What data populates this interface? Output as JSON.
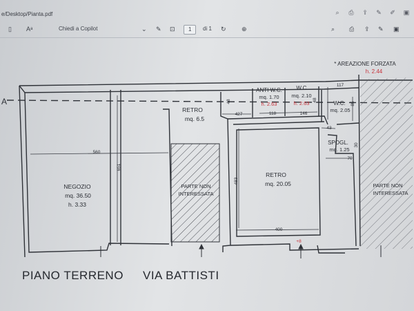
{
  "browser": {
    "url": "e/Desktop/Pianta.pdf",
    "tab_icons": [
      "back-icon",
      "print-icon",
      "share-icon",
      "highlight-icon",
      "draw-icon",
      "save-icon"
    ]
  },
  "toolbar": {
    "ask_copilot": "Chiedi a Copilot",
    "page_current": "1",
    "page_total": "di 1",
    "icons": [
      "sidebar-icon",
      "read-aloud-icon",
      "draw-icon",
      "fit-page-icon",
      "rotate-icon",
      "zoom-icon"
    ]
  },
  "plan": {
    "left_marker": "A",
    "aeration": {
      "title": "* AREAZIONE FORZATA",
      "height": "h. 2.44"
    },
    "anti_wc": {
      "title": "ANTI W.C.",
      "area": "mq. 1.70",
      "height": "h. 2.63"
    },
    "wc1": {
      "title": "W.C.",
      "area": "mq. 2.10",
      "height": "h. 2.63"
    },
    "wc2": {
      "title": "W.C.",
      "area": "mq. 2.05"
    },
    "retro_small": {
      "title": "RETRO",
      "area": "mq. 6.5"
    },
    "retro_big": {
      "title": "RETRO",
      "area": "mq. 20.05"
    },
    "spogl": {
      "title": "SPOGL.",
      "area": "mq. 1.25"
    },
    "negozio": {
      "title": "NEGOZIO",
      "area": "mq. 36.50",
      "height": "h. 3.33"
    },
    "excluded_1": {
      "line1": "PARTE NON",
      "line2": "INTERESSATA"
    },
    "excluded_2": {
      "line1": "PARTE NON",
      "line2": "INTERESSATA"
    },
    "dims": {
      "d560": "560",
      "d651": "651",
      "d483": "483",
      "d400": "400",
      "d427": "427",
      "d118": "118",
      "d146": "146",
      "d117": "117",
      "d43": "43",
      "d70": "70",
      "d48": "48",
      "d85": "85",
      "d48b": "48",
      "d30": "30",
      "plus8": "+8"
    }
  },
  "footer": {
    "floor": "PIANO TERRENO",
    "street": "VIA BATTISTI"
  },
  "colors": {
    "ink": "#2f3238",
    "red": "#c8323a",
    "paper": "#e3e5e7"
  }
}
